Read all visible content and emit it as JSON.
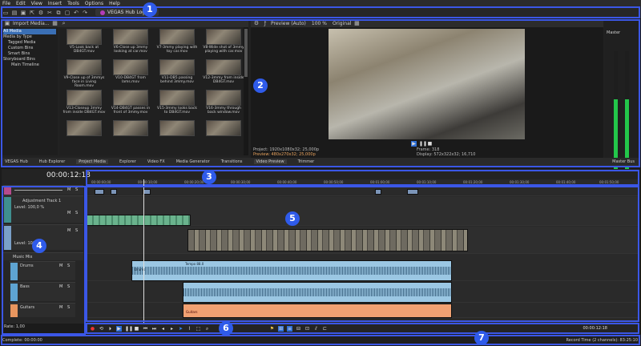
{
  "menu": [
    "File",
    "Edit",
    "View",
    "Insert",
    "Tools",
    "Options",
    "Help"
  ],
  "app_title": "VEGAS Hub Logged",
  "explorer": {
    "import_label": "Import Media...",
    "tree": [
      "All Media",
      "Media by Type",
      "Tagged Media",
      "Custom Bins",
      "Smart Bins",
      "Storyboard Bins",
      "Main Timeline"
    ],
    "thumbs": [
      "V5-Look back at DB4GT.mov",
      "V6-Close up 3mmy looking at car.mov",
      "V7-3mmy playing with toy car.mov",
      "V8-Wide shot of 3mmy playing with car.mov",
      "V9-Close up of 3mmys face in Living Room.mov",
      "V10-DB4GT from lams.mov",
      "V11-DB5 passing behind 3mmy.mov",
      "V12-3mmy from inside DB4GT.mov",
      "V13-Closeup 3mmy from inside DB4GT.mov",
      "V14-DB4GT passes in front of 3mmy.mov",
      "V15-3mmy looks back to DB4GT.mov",
      "V16-3mmy through back window.mov",
      "",
      "",
      "",
      ""
    ]
  },
  "preview": {
    "toolbar_label": "Preview (Auto)",
    "zoom": "100 %",
    "mode": "Original",
    "project_info": "Project:  1920x1080x32; 25,000p",
    "preview_info": "Preview:  480x270x32; 25,000p",
    "frame_info": "Frame:     318",
    "display_info": "Display:   572x322x32; 16,710"
  },
  "master": {
    "label": "Master",
    "bus_tab": "Master Bus"
  },
  "tabs": [
    "VEGAS Hub",
    "Hub Explorer",
    "Project Media",
    "Explorer",
    "Video FX",
    "Media Generator",
    "Transitions",
    "Video Preview",
    "Trimmer"
  ],
  "timeline": {
    "timecode": "00:00:12:18",
    "ruler": [
      "00:00:00;00",
      "00:00:10;00",
      "00:00:20;00",
      "00:00:30;00",
      "00:00:40;00",
      "00:00:50;00",
      "00:01:00;00",
      "00:01:10;00",
      "00:01:20;00",
      "00:01:30;00",
      "00:01:40;00",
      "00:01:50;00"
    ],
    "adjustment_track": "Adjustment Track 1",
    "level_label": "Level: 100,0 %",
    "music_mix": "Music Mix",
    "audio_tracks": [
      "Drums",
      "Bass",
      "Guitars"
    ],
    "rate": "Rate: 1,00",
    "tempo_label": "Tempo 88.0",
    "drum_clip": "Drums",
    "guitar_clip": "Guitars"
  },
  "transport_time": "00:00:12:18",
  "status": {
    "left": "Complete: 00:00:00",
    "right": "Record Time (2 channels): 83:25:10"
  },
  "callouts": [
    "1",
    "2",
    "3",
    "4",
    "5",
    "6",
    "7"
  ],
  "colors": {
    "highlight": "#3b57e6",
    "badge": "#2f5bea",
    "audio": "#9bc7e3",
    "guitar": "#f1a172",
    "meter": "#23c64a"
  }
}
